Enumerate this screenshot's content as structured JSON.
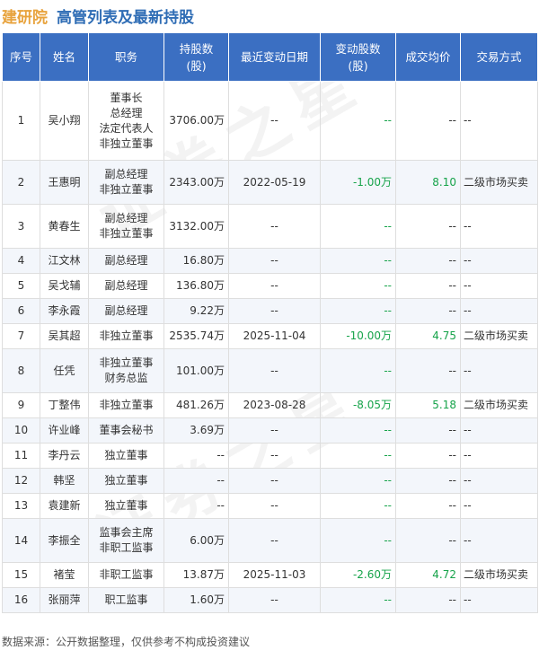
{
  "header": {
    "company": "建研院",
    "report_title": "高管列表及最新持股"
  },
  "table": {
    "columns": [
      "序号",
      "姓名",
      "职务",
      "持股数(股)",
      "最近变动日期",
      "变动股数(股)",
      "成交均价",
      "交易方式"
    ],
    "rows": [
      {
        "no": "1",
        "name": "吴小翔",
        "positions": [
          "董事长",
          "总经理",
          "法定代表人",
          "非独立董事"
        ],
        "shares": "3706.00万",
        "date": "--",
        "change": "--",
        "price": "--",
        "method": "--"
      },
      {
        "no": "2",
        "name": "王惠明",
        "positions": [
          "副总经理",
          "非独立董事"
        ],
        "shares": "2343.00万",
        "date": "2022-05-19",
        "change": "-1.00万",
        "price": "8.10",
        "method": "二级市场买卖"
      },
      {
        "no": "3",
        "name": "黄春生",
        "positions": [
          "副总经理",
          "非独立董事"
        ],
        "shares": "3132.00万",
        "date": "--",
        "change": "--",
        "price": "--",
        "method": "--"
      },
      {
        "no": "4",
        "name": "江文林",
        "positions": [
          "副总经理"
        ],
        "shares": "16.80万",
        "date": "--",
        "change": "--",
        "price": "--",
        "method": "--"
      },
      {
        "no": "5",
        "name": "吴戈辅",
        "positions": [
          "副总经理"
        ],
        "shares": "136.80万",
        "date": "--",
        "change": "--",
        "price": "--",
        "method": "--"
      },
      {
        "no": "6",
        "name": "李永霞",
        "positions": [
          "副总经理"
        ],
        "shares": "9.22万",
        "date": "--",
        "change": "--",
        "price": "--",
        "method": "--"
      },
      {
        "no": "7",
        "name": "吴其超",
        "positions": [
          "非独立董事"
        ],
        "shares": "2535.74万",
        "date": "2025-11-04",
        "change": "-10.00万",
        "price": "4.75",
        "method": "二级市场买卖"
      },
      {
        "no": "8",
        "name": "任凭",
        "positions": [
          "非独立董事",
          "财务总监"
        ],
        "shares": "101.00万",
        "date": "--",
        "change": "--",
        "price": "--",
        "method": "--"
      },
      {
        "no": "9",
        "name": "丁整伟",
        "positions": [
          "非独立董事"
        ],
        "shares": "481.26万",
        "date": "2023-08-28",
        "change": "-8.05万",
        "price": "5.18",
        "method": "二级市场买卖"
      },
      {
        "no": "10",
        "name": "许业峰",
        "positions": [
          "董事会秘书"
        ],
        "shares": "3.69万",
        "date": "--",
        "change": "--",
        "price": "--",
        "method": "--"
      },
      {
        "no": "11",
        "name": "李丹云",
        "positions": [
          "独立董事"
        ],
        "shares": "--",
        "date": "--",
        "change": "--",
        "price": "--",
        "method": "--"
      },
      {
        "no": "12",
        "name": "韩坚",
        "positions": [
          "独立董事"
        ],
        "shares": "--",
        "date": "--",
        "change": "--",
        "price": "--",
        "method": "--"
      },
      {
        "no": "13",
        "name": "袁建新",
        "positions": [
          "独立董事"
        ],
        "shares": "--",
        "date": "--",
        "change": "--",
        "price": "--",
        "method": "--"
      },
      {
        "no": "14",
        "name": "李振全",
        "positions": [
          "监事会主席",
          "非职工监事"
        ],
        "shares": "6.00万",
        "date": "--",
        "change": "--",
        "price": "--",
        "method": "--"
      },
      {
        "no": "15",
        "name": "褚莹",
        "positions": [
          "非职工监事"
        ],
        "shares": "13.87万",
        "date": "2025-11-03",
        "change": "-2.60万",
        "price": "4.72",
        "method": "二级市场买卖"
      },
      {
        "no": "16",
        "name": "张丽萍",
        "positions": [
          "职工监事"
        ],
        "shares": "1.60万",
        "date": "--",
        "change": "--",
        "price": "--",
        "method": "--"
      }
    ]
  },
  "footer": {
    "source": "数据来源：公开数据整理，仅供参考不构成投资建议"
  },
  "watermark": {
    "text": "证券之星"
  }
}
